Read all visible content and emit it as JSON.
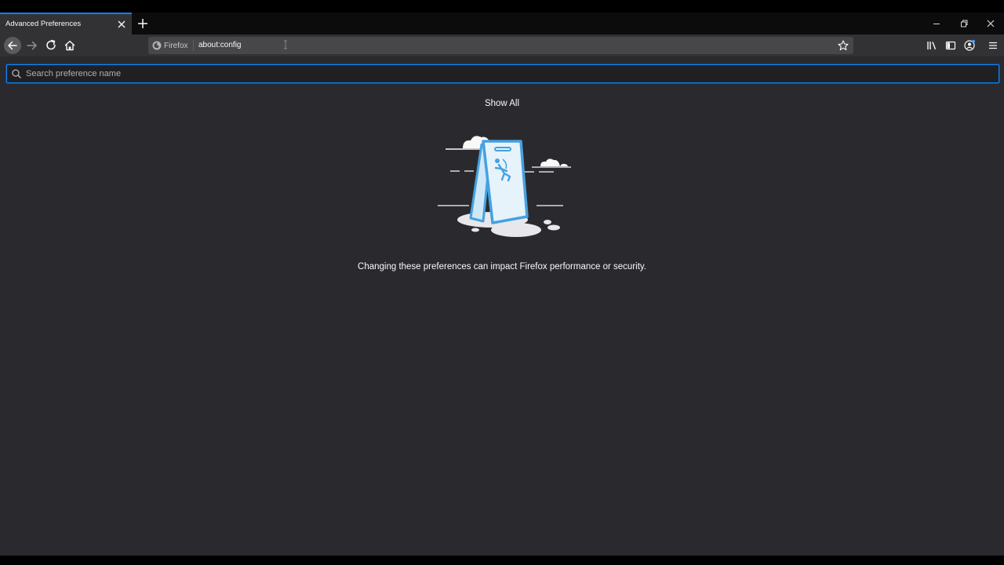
{
  "tab": {
    "title": "Advanced Preferences"
  },
  "urlbar": {
    "identity_label": "Firefox",
    "url": "about:config"
  },
  "search": {
    "placeholder": "Search preference name"
  },
  "content": {
    "show_all_label": "Show All",
    "warning_text": "Changing these preferences can impact Firefox performance or security."
  },
  "colors": {
    "accent": "#0a84ff",
    "background": "#2a2a2e",
    "illustration_blue": "#45a1e0"
  },
  "icons": [
    "close-icon",
    "plus-icon",
    "minimize-icon",
    "restore-icon",
    "back-arrow-icon",
    "forward-arrow-icon",
    "reload-icon",
    "home-icon",
    "firefox-logo-icon",
    "star-icon",
    "library-icon",
    "sidebar-icon",
    "account-icon",
    "hamburger-menu-icon",
    "search-icon"
  ]
}
